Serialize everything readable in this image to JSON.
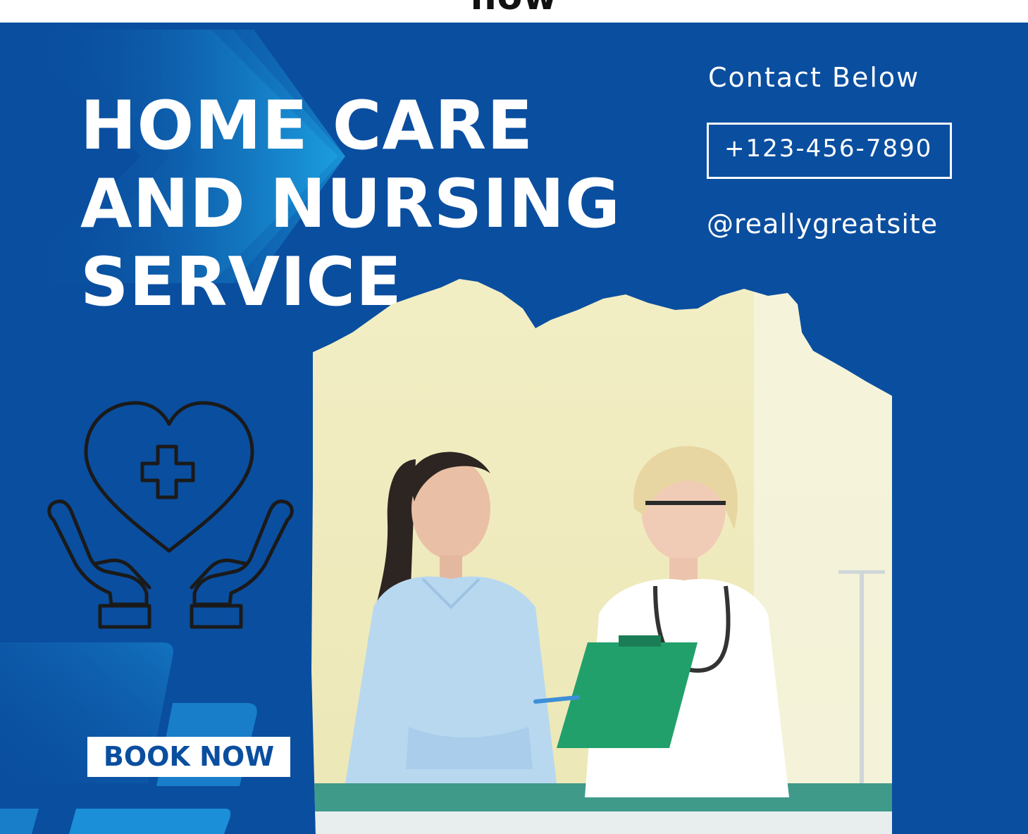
{
  "top_strip": {
    "text": "now"
  },
  "headline": {
    "line1": "HOME CARE",
    "line2": "AND NURSING",
    "line3": "SERVICE"
  },
  "contact": {
    "heading": "Contact Below",
    "phone": "+123-456-7890",
    "website": "@reallygreatsite"
  },
  "cta": {
    "label": "BOOK NOW"
  },
  "icons": {
    "care": "heart-cross-hands-icon"
  },
  "colors": {
    "background": "#0a4e9f",
    "accent": "#1fa8e6",
    "text": "#ffffff",
    "icon_stroke": "#1a1a1a"
  }
}
